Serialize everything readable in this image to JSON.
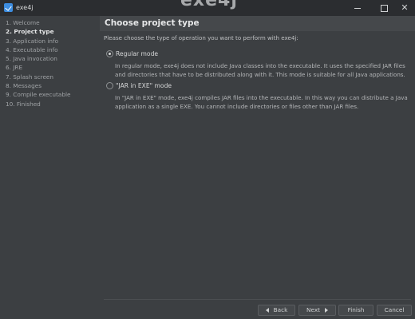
{
  "window": {
    "title": "exe4j",
    "banner": "exe4j",
    "app_icon": "exe4j-icon",
    "controls": [
      "minimize-icon",
      "maximize-icon",
      "close-icon"
    ]
  },
  "sidebar": {
    "items": [
      {
        "label": "1. Welcome"
      },
      {
        "label": "2. Project type"
      },
      {
        "label": "3. Application info"
      },
      {
        "label": "4. Executable info"
      },
      {
        "label": "5. Java invocation"
      },
      {
        "label": "6. JRE"
      },
      {
        "label": "7. Splash screen"
      },
      {
        "label": "8. Messages"
      },
      {
        "label": "9. Compile executable"
      },
      {
        "label": "10. Finished"
      }
    ],
    "active_index": 1
  },
  "main": {
    "title": "Choose project type",
    "intro": "Please choose the type of operation you want to perform with exe4j:",
    "options": [
      {
        "label": "Regular mode",
        "selected": true,
        "description": "In regular mode, exe4j does not include Java classes into the executable. It uses the specified JAR files and directories that have to be distributed along with it. This mode is suitable for all Java applications."
      },
      {
        "label": "\"JAR in EXE\" mode",
        "selected": false,
        "description": "In \"JAR in EXE\" mode, exe4j compiles JAR files into the executable. In this way you can distribute a Java application as a single EXE. You cannot include directories or files other than JAR files."
      }
    ]
  },
  "footer": {
    "back_label": "Back",
    "next_label": "Next",
    "finish_label": "Finish",
    "cancel_label": "Cancel"
  },
  "colors": {
    "background": "#3c3f42",
    "titlebar": "#2b2d30",
    "header": "#45484b",
    "accent_icon": "#3d8de0"
  }
}
